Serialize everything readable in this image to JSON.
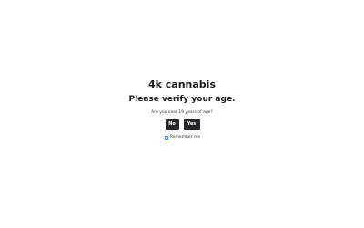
{
  "age_gate": {
    "brand": "4k cannabis",
    "heading": "Please verify your age.",
    "question": "Are you over 19 years of age?",
    "no_label": "No",
    "yes_label": "Yes",
    "remember_label": "Remember me",
    "remember_checked": true
  },
  "colors": {
    "background": "#ffffff",
    "button_bg": "#232528",
    "button_text": "#ffffff",
    "checkbox_accent": "#2f6fde"
  }
}
